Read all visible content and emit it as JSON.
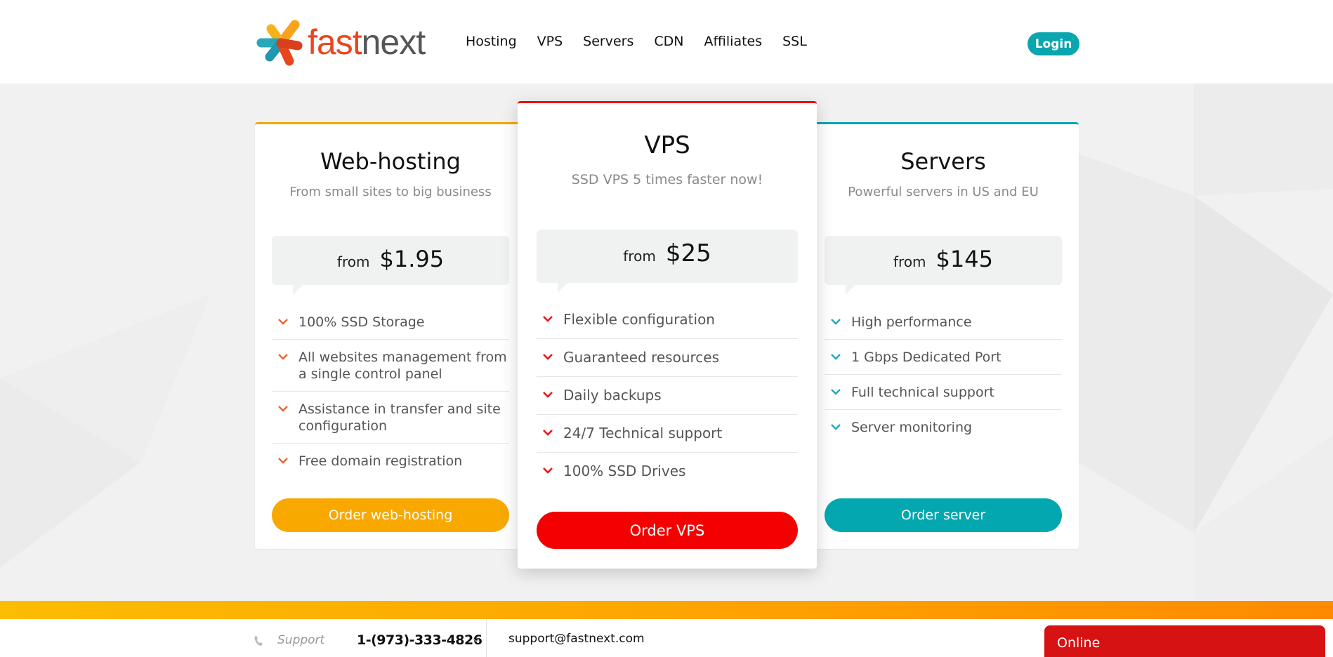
{
  "brand": {
    "name_part1": "fast",
    "name_part2": "next",
    "colors": {
      "orange": "#e8471e",
      "gray": "#555555",
      "teal": "#0aa6b0",
      "yellow": "#f7a600"
    }
  },
  "nav": {
    "items": [
      {
        "label": "Hosting"
      },
      {
        "label": "VPS"
      },
      {
        "label": "Servers"
      },
      {
        "label": "CDN"
      },
      {
        "label": "Affiliates"
      },
      {
        "label": "SSL"
      }
    ],
    "login_label": "Login"
  },
  "plans": [
    {
      "id": "web-hosting",
      "title": "Web-hosting",
      "subtitle": "From small sites to big business",
      "price_prefix": "from",
      "price": "$1.95",
      "accent": "#f7a600",
      "check_color": "#f0642d",
      "features": [
        "100% SSD Storage",
        "All websites management from a single control panel",
        "Assistance in transfer and site configuration",
        "Free domain registration"
      ],
      "button_label": "Order web-hosting"
    },
    {
      "id": "vps",
      "title": "VPS",
      "subtitle": "SSD VPS 5 times faster now!",
      "price_prefix": "from",
      "price": "$25",
      "accent": "#f00000",
      "check_color": "#e8181e",
      "features": [
        "Flexible configuration",
        "Guaranteed resources",
        "Daily backups",
        "24/7 Technical support",
        "100% SSD Drives"
      ],
      "button_label": "Order VPS"
    },
    {
      "id": "servers",
      "title": "Servers",
      "subtitle": "Powerful servers in US and EU",
      "price_prefix": "from",
      "price": "$145",
      "accent": "#0aa6b0",
      "check_color": "#20a7bd",
      "features": [
        "High performance",
        "1 Gbps Dedicated Port",
        "Full technical support",
        "Server monitoring"
      ],
      "button_label": "Order server"
    }
  ],
  "footer": {
    "support_label": "Support",
    "phone": "1-(973)-333-4826",
    "email": "support@fastnext.com",
    "chat_label": "Online"
  }
}
